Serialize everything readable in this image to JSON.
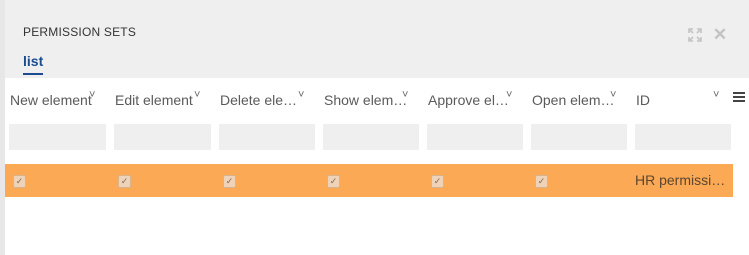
{
  "panel": {
    "title": "PERMISSION SETS",
    "tab": "list",
    "accent_color": "#1a4c8f",
    "highlight_row_color": "#fba954"
  },
  "icons": {
    "expand": "expand-icon",
    "close": "close-icon",
    "menu": "hamburger-menu-icon",
    "sort": "chevron-down-icon"
  },
  "columns": [
    "New element",
    "Edit element",
    "Delete ele…",
    "Show elem…",
    "Approve el…",
    "Open elem…",
    "ID"
  ],
  "rows": [
    {
      "checks": [
        true,
        true,
        true,
        true,
        true,
        true
      ],
      "id": "HR permissi…"
    }
  ]
}
